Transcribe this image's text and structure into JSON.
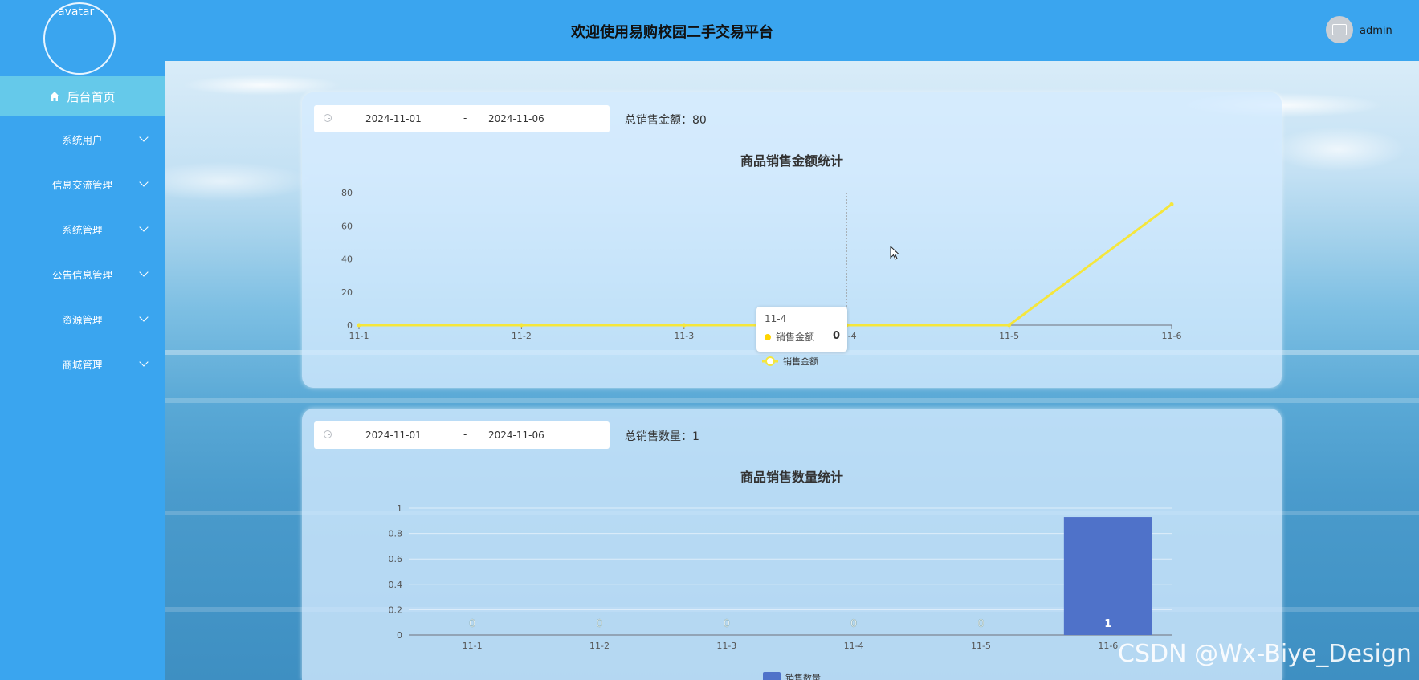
{
  "sidebar": {
    "avatar_alt": "avatar",
    "home_label": "后台首页",
    "items": [
      {
        "label": "系统用户"
      },
      {
        "label": "信息交流管理"
      },
      {
        "label": "系统管理"
      },
      {
        "label": "公告信息管理"
      },
      {
        "label": "资源管理"
      },
      {
        "label": "商城管理"
      }
    ]
  },
  "header": {
    "title": "欢迎使用易购校园二手交易平台",
    "user": "admin"
  },
  "sales_amount_panel": {
    "date_start": "2024-11-01",
    "date_sep": "-",
    "date_end": "2024-11-06",
    "total_label": "总销售金额：",
    "total_value": "80",
    "tooltip": {
      "date": "11-4",
      "series": "销售金额",
      "value": "0"
    }
  },
  "sales_count_panel": {
    "date_start": "2024-11-01",
    "date_sep": "-",
    "date_end": "2024-11-06",
    "total_label": "总销售数量：",
    "total_value": "1"
  },
  "chart_data": [
    {
      "type": "line",
      "title": "商品销售金额统计",
      "categories": [
        "11-1",
        "11-2",
        "11-3",
        "11-4",
        "11-5",
        "11-6"
      ],
      "series": [
        {
          "name": "销售金额",
          "values": [
            0,
            0,
            0,
            0,
            0,
            73
          ],
          "color": "#f5e63c"
        }
      ],
      "yticks": [
        0,
        20,
        40,
        60,
        80
      ],
      "ylim": [
        0,
        80
      ],
      "legend_position": "bottom-center"
    },
    {
      "type": "bar",
      "title": "商品销售数量统计",
      "categories": [
        "11-1",
        "11-2",
        "11-3",
        "11-4",
        "11-5",
        "11-6"
      ],
      "series": [
        {
          "name": "销售数量",
          "values": [
            0,
            0,
            0,
            0,
            0,
            0.93
          ],
          "labels": [
            "0",
            "0",
            "0",
            "0",
            "0",
            "1"
          ],
          "color": "#4f72c9"
        }
      ],
      "yticks": [
        0,
        0.2,
        0.4,
        0.6,
        0.8,
        1
      ],
      "ylim": [
        0,
        1
      ],
      "legend_position": "bottom-center"
    }
  ],
  "watermark": "CSDN @Wx-Biye_Design"
}
